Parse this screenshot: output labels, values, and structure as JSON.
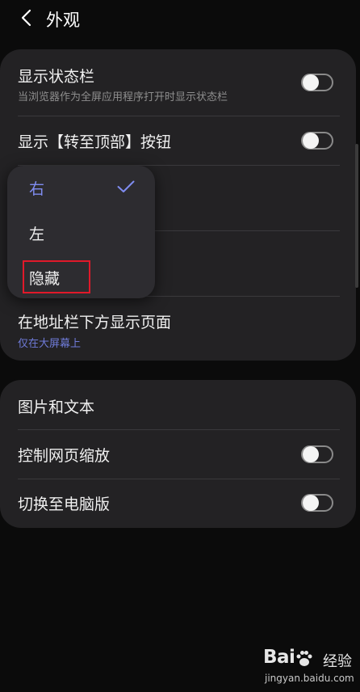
{
  "header": {
    "title": "外观"
  },
  "card1": {
    "status_bar": {
      "title": "显示状态栏",
      "subtitle": "当浏览器作为全屏应用程序打开时显示状态栏",
      "enabled": false
    },
    "top_button": {
      "title": "显示【转至顶部】按钮",
      "enabled": false
    },
    "address_bar": {
      "title": "在地址栏下方显示页面",
      "subtitle": "仅在大屏幕上"
    }
  },
  "popup": {
    "options": [
      {
        "label": "右",
        "selected": true
      },
      {
        "label": "左",
        "selected": false
      },
      {
        "label": "隐藏",
        "selected": false
      }
    ]
  },
  "card2": {
    "images_text": {
      "title": "图片和文本"
    },
    "zoom": {
      "title": "控制网页缩放",
      "enabled": false
    },
    "desktop": {
      "title": "切换至电脑版",
      "enabled": false
    }
  },
  "watermark": {
    "logo_left": "Bai",
    "logo_right": "经验",
    "url": "jingyan.baidu.com"
  },
  "colors": {
    "accent": "#7f8cf0",
    "highlight": "#e0192a",
    "card": "#232224",
    "background": "#0b0b0b"
  }
}
